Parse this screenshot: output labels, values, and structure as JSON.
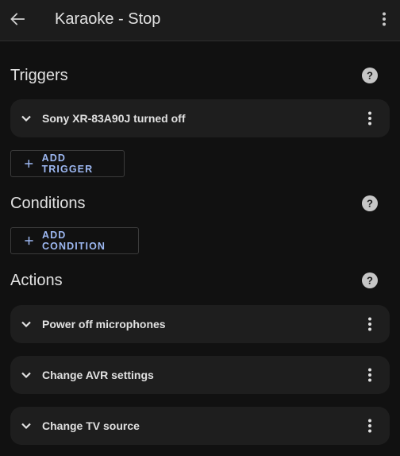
{
  "header": {
    "title": "Karaoke - Stop",
    "back_icon": "arrow-left-icon",
    "menu_icon": "more-vertical-icon"
  },
  "triggers": {
    "title": "Triggers",
    "help_icon": "help-circle-icon",
    "items": [
      {
        "label": "Sony XR-83A90J turned off"
      }
    ],
    "add_label": "ADD TRIGGER"
  },
  "conditions": {
    "title": "Conditions",
    "help_icon": "help-circle-icon",
    "add_label": "ADD CONDITION"
  },
  "actions": {
    "title": "Actions",
    "help_icon": "help-circle-icon",
    "items": [
      {
        "label": "Power off microphones"
      },
      {
        "label": "Change AVR settings"
      },
      {
        "label": "Change TV source"
      }
    ]
  },
  "colors": {
    "background": "#111111",
    "card": "#1e1e1e",
    "accent": "#9db8f2",
    "text": "#e1e1e1"
  }
}
